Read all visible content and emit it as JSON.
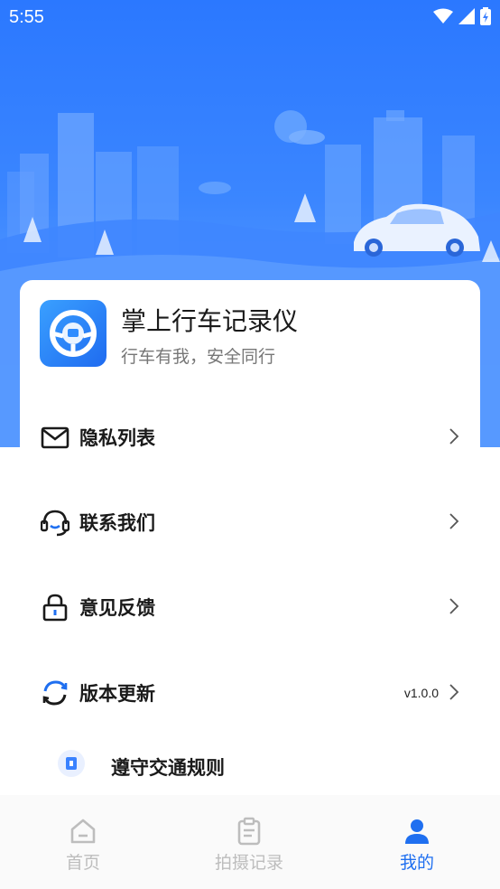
{
  "status_bar": {
    "time": "5:55"
  },
  "app": {
    "name": "掌上行车记录仪",
    "slogan": "行车有我，安全同行"
  },
  "menu": [
    {
      "label": "隐私列表",
      "icon": "mail-icon"
    },
    {
      "label": "联系我们",
      "icon": "headset-icon"
    },
    {
      "label": "意见反馈",
      "icon": "lock-icon"
    },
    {
      "label": "版本更新",
      "icon": "refresh-icon",
      "value": "v1.0.0"
    }
  ],
  "partial_item": {
    "label": "遵守交通规则",
    "icon": "badge-icon"
  },
  "tabbar": {
    "items": [
      {
        "label": "首页",
        "icon": "home-icon",
        "active": false
      },
      {
        "label": "拍摄记录",
        "icon": "clipboard-icon",
        "active": false
      },
      {
        "label": "我的",
        "icon": "user-icon",
        "active": true
      }
    ]
  },
  "colors": {
    "primary": "#1f6ff0",
    "hero": "#2b78ff",
    "inactive": "#bdbdbd"
  }
}
